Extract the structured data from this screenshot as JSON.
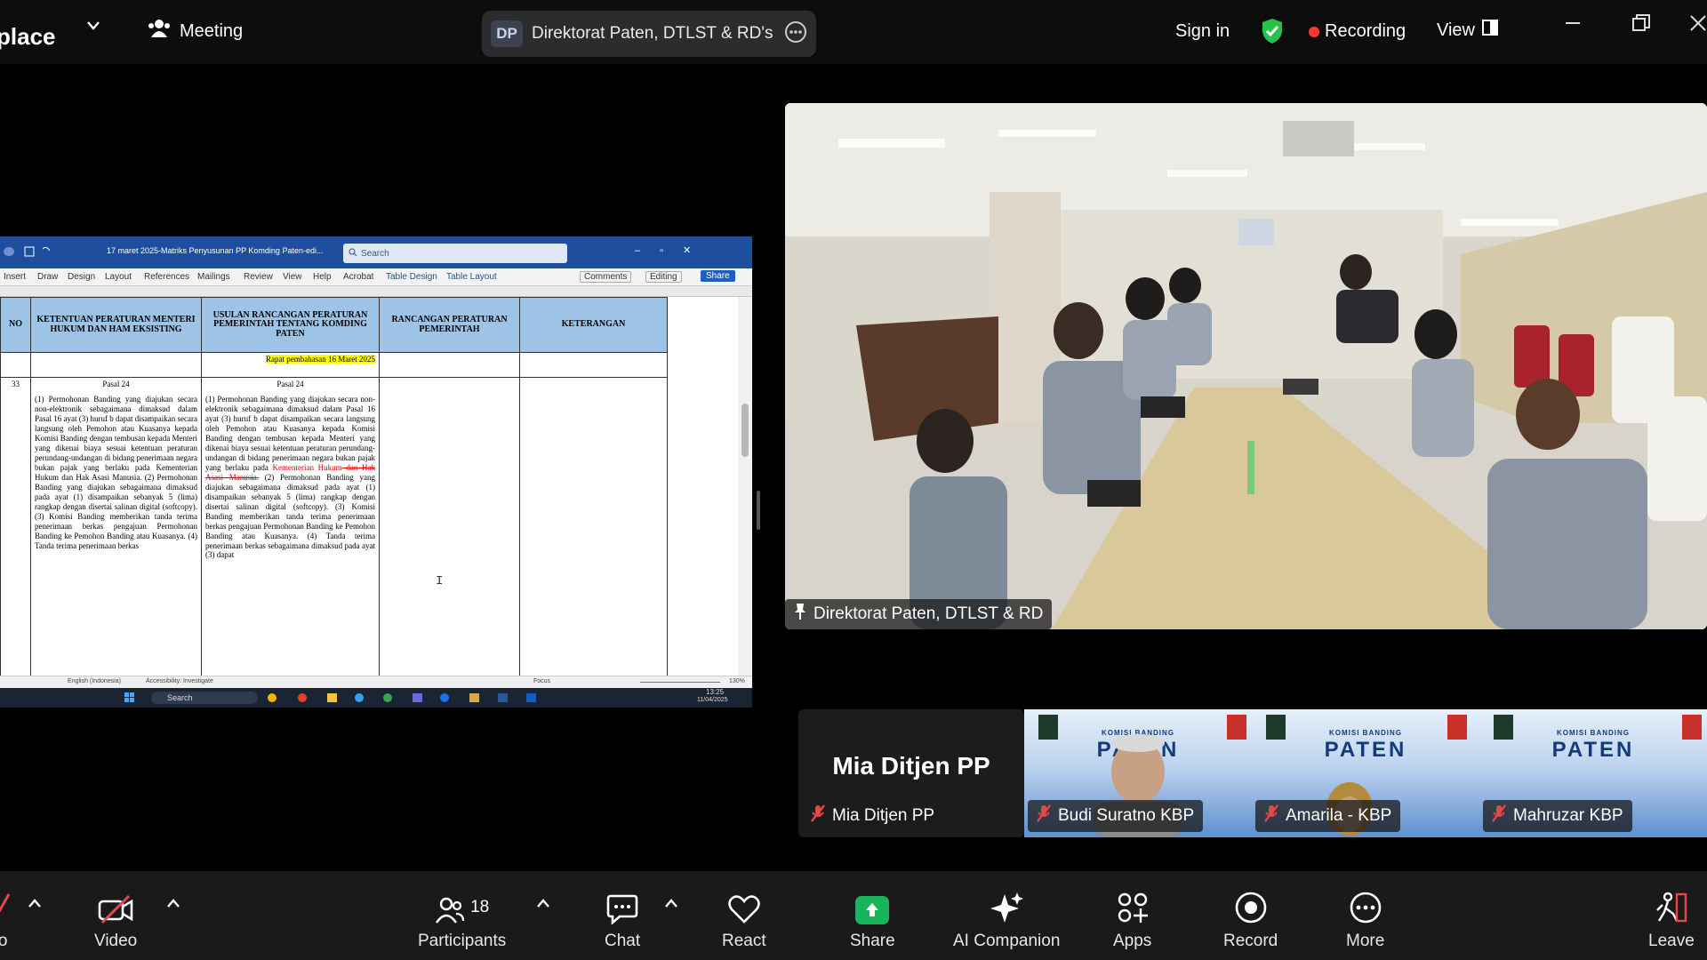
{
  "topbar": {
    "app_name": "place",
    "meeting_label": "Meeting",
    "meeting_badge": "DP",
    "meeting_title": "Direktorat Paten, DTLST & RD's s",
    "sign_in": "Sign in",
    "recording": "Recording",
    "view": "View"
  },
  "shared_screen": {
    "doc_title": "17 maret 2025-Matriks Penyusunan PP Komding Paten-edi...",
    "search_placeholder": "Search",
    "ribbon_tabs": [
      "Insert",
      "Draw",
      "Design",
      "Layout",
      "References",
      "Mailings",
      "Review",
      "View",
      "Help",
      "Acrobat",
      "Table Design",
      "Table Layout"
    ],
    "comments": "Comments",
    "editing": "Editing",
    "share": "Share",
    "table": {
      "headers": [
        "NO",
        "KETENTUAN PERATURAN MENTERI HUKUM DAN HAM EKSISTING",
        "USULAN RANCANGAN PERATURAN PEMERINTAH TENTANG KOMDING PATEN",
        "RANCANGAN PERATURAN PEMERINTAH",
        "KETERANGAN"
      ],
      "note_highlight": "Rapat pembahasan 16 Maret 2025",
      "row_no": "33",
      "pasal": "Pasal 24",
      "col1": "(1) Permohonan Banding yang diajukan secara non-elektronik sebagaimana dimaksud dalam Pasal 16 ayat (3) huruf b dapat disampaikan secara langsung oleh Pemohon atau Kuasanya kepada Komisi Banding dengan tembusan kepada Menteri yang dikenai biaya sesuai ketentuan peraturan perundang-undangan di bidang penerimaan negara bukan pajak yang berlaku pada Kementerian Hukum dan Hak Asasi Manusia. (2) Permohonan Banding yang diajukan sebagaimana dimaksud pada ayat (1) disampaikan sebanyak 5 (lima) rangkap dengan disertai salinan digital (softcopy). (3) Komisi Banding memberikan tanda terima penerimaan berkas pengajuan Permohonan Banding ke Pemohon Banding atau Kuasanya. (4) Tanda terima penerimaan berkas",
      "col2_a": "(1) Permohonan Banding yang diajukan secara non-elektronik sebagaimana dimaksud dalam Pasal 16 ayat (3) huruf b dapat disampaikan secara langsung oleh Pemohon atau Kuasanya kepada Komisi Banding dengan tembusan kepada Menteri yang dikenai biaya sesuai ketentuan peraturan perundang-undangan di bidang penerimaan negara bukan pajak yang berlaku pada ",
      "col2_red": "Kementerian Hukum",
      "col2_strike": " dan Hak Asasi Manusia.",
      "col2_b": " (2) Permohonan Banding yang diajukan sebagaimana dimaksud pada ayat (1) disampaikan sebanyak 5 (lima) rangkap dengan disertai salinan digital (softcopy). (3) Komisi Banding memberikan tanda terima penerimaan berkas pengajuan Permohonan Banding ke Pemohon Banding atau Kuasanya. (4) Tanda terima penerimaan berkas sebagaimana dimaksud pada ayat (3) dapat"
    },
    "status_lang": "English (Indonesia)",
    "status_access": "Accessibility: Investigate",
    "status_focus": "Focus",
    "status_zoom": "130%",
    "taskbar_search": "Search",
    "clock_time": "13:25",
    "clock_date": "11/04/2025"
  },
  "participants": {
    "room_name": "Direktorat Paten, DTLST & RD",
    "mia_display": "Mia Ditjen PP",
    "mia_tag": "Mia Ditjen PP",
    "p1": "Budi Suratno KBP",
    "p2": "Amarila - KBP",
    "p3": "Mahruzar KBP",
    "banner_small": "KOMISI BANDING",
    "banner_big": "PATEN"
  },
  "toolbar": {
    "audio": "io",
    "video": "Video",
    "participants": "Participants",
    "participants_count": "18",
    "chat": "Chat",
    "react": "React",
    "share": "Share",
    "ai_companion": "AI Companion",
    "apps": "Apps",
    "record": "Record",
    "more": "More",
    "leave": "Leave"
  },
  "colors": {
    "recording_dot": "#ff3b30",
    "share_green": "#18b35a",
    "word_blue": "#1f4e9e",
    "table_header": "#9dc3e6",
    "shield_green": "#27c24c"
  }
}
